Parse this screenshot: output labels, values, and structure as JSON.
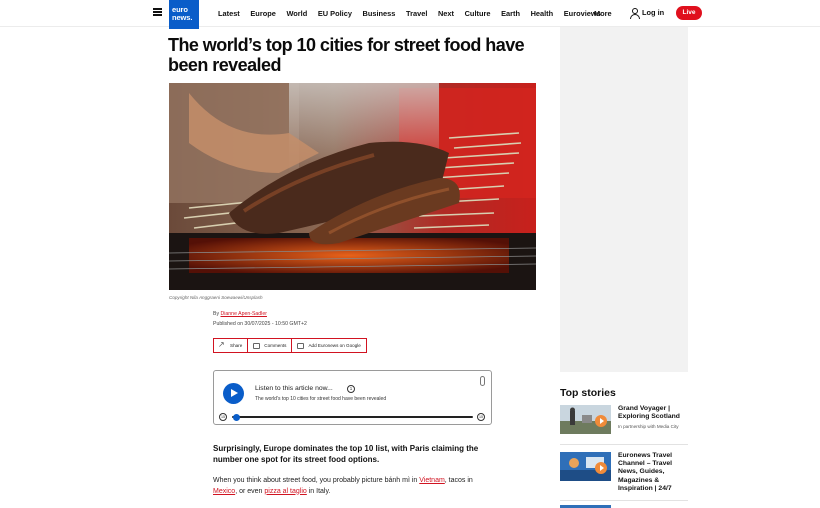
{
  "header": {
    "logo_line1": "euro",
    "logo_line2": "news.",
    "nav": [
      "Latest",
      "Europe",
      "World",
      "EU Policy",
      "Business",
      "Travel",
      "Next",
      "Culture",
      "Earth",
      "Health",
      "Euroviews"
    ],
    "more": "More",
    "login": "Log in",
    "live": "Live"
  },
  "article": {
    "title": "The world’s top 10 cities for street food have been revealed",
    "copyright": "Copyright Nila Anggraeni Soewaewi/Unsplash",
    "byline_prefix": "By",
    "author": "Dianne Apen-Sadler",
    "published": "Published on 30/07/2025 - 10:50 GMT+2",
    "actions": {
      "share": "Share",
      "comments": "Comments",
      "google": "Add Euronews on Google"
    },
    "lead": "Surprisingly, Europe dominates the top 10 list, with Paris claiming the number one spot for its street food options.",
    "body": {
      "t1": "When you think about street food, you probably picture bánh mì in ",
      "link1": "Vietnam",
      "t2": ", tacos in ",
      "link2": "Mexico",
      "t3": ", or even ",
      "link3": "pizza al taglio",
      "t4": " in Italy."
    }
  },
  "player": {
    "listen": "Listen to this article now...",
    "subtitle": "The world’s top 10 cities for street food have been revealed",
    "speed": "1",
    "rewind": "15",
    "forward": "15",
    "progress": 0.02
  },
  "sidebar": {
    "top_stories": "Top stories",
    "stories": [
      {
        "title": "Grand Voyager | Exploring Scotland",
        "partner_prefix": "In partnership with",
        "partner": "Media City"
      },
      {
        "title": "Euronews Travel Channel – Travel News, Guides, Magazines & Inspiration | 24/7"
      }
    ]
  },
  "colors": {
    "brand_blue": "#0a5dc9",
    "accent_red": "#d11321",
    "live_red": "#e0101d"
  }
}
